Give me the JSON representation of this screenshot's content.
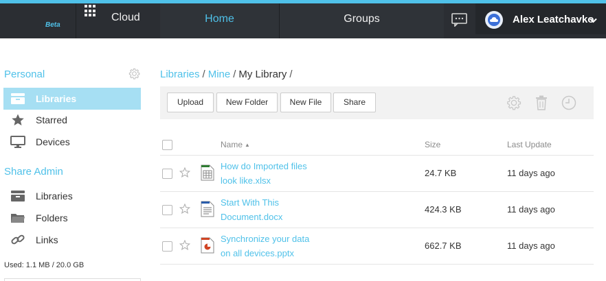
{
  "topbar": {
    "beta": "Beta",
    "cloud": "Cloud",
    "home": "Home",
    "groups": "Groups",
    "user_name": "Alex Leatchavko",
    "accent": "#4fc1e9",
    "background": "#2b2e33"
  },
  "sidebar": {
    "personal_title": "Personal",
    "personal_items": [
      {
        "label": "Libraries",
        "icon": "library-icon",
        "active": true
      },
      {
        "label": "Starred",
        "icon": "star-icon",
        "active": false
      },
      {
        "label": "Devices",
        "icon": "monitor-icon",
        "active": false
      }
    ],
    "share_admin_title": "Share Admin",
    "share_admin_items": [
      {
        "label": "Libraries",
        "icon": "library-icon"
      },
      {
        "label": "Folders",
        "icon": "folder-icon"
      },
      {
        "label": "Links",
        "icon": "link-icon"
      }
    ],
    "used": "Used: 1.1 MB / 20.0 GB"
  },
  "breadcrumb": {
    "items": [
      "Libraries",
      "Mine",
      "My Library"
    ],
    "separator": "/"
  },
  "toolbar": {
    "upload": "Upload",
    "new_folder": "New Folder",
    "new_file": "New File",
    "share": "Share"
  },
  "table": {
    "columns": {
      "name": "Name",
      "sort_indicator": "▲",
      "size": "Size",
      "last_update": "Last Update"
    },
    "rows": [
      {
        "name_line1": "How do Imported files",
        "name_line2": "look like.xlsx",
        "size": "24.7 KB",
        "updated": "11 days ago",
        "type": "spreadsheet-icon"
      },
      {
        "name_line1": "Start With This",
        "name_line2": "Document.docx",
        "size": "424.3 KB",
        "updated": "11 days ago",
        "type": "document-icon"
      },
      {
        "name_line1": "Synchronize your data",
        "name_line2": "on all devices.pptx",
        "size": "662.7 KB",
        "updated": "11 days ago",
        "type": "presentation-icon"
      }
    ]
  }
}
